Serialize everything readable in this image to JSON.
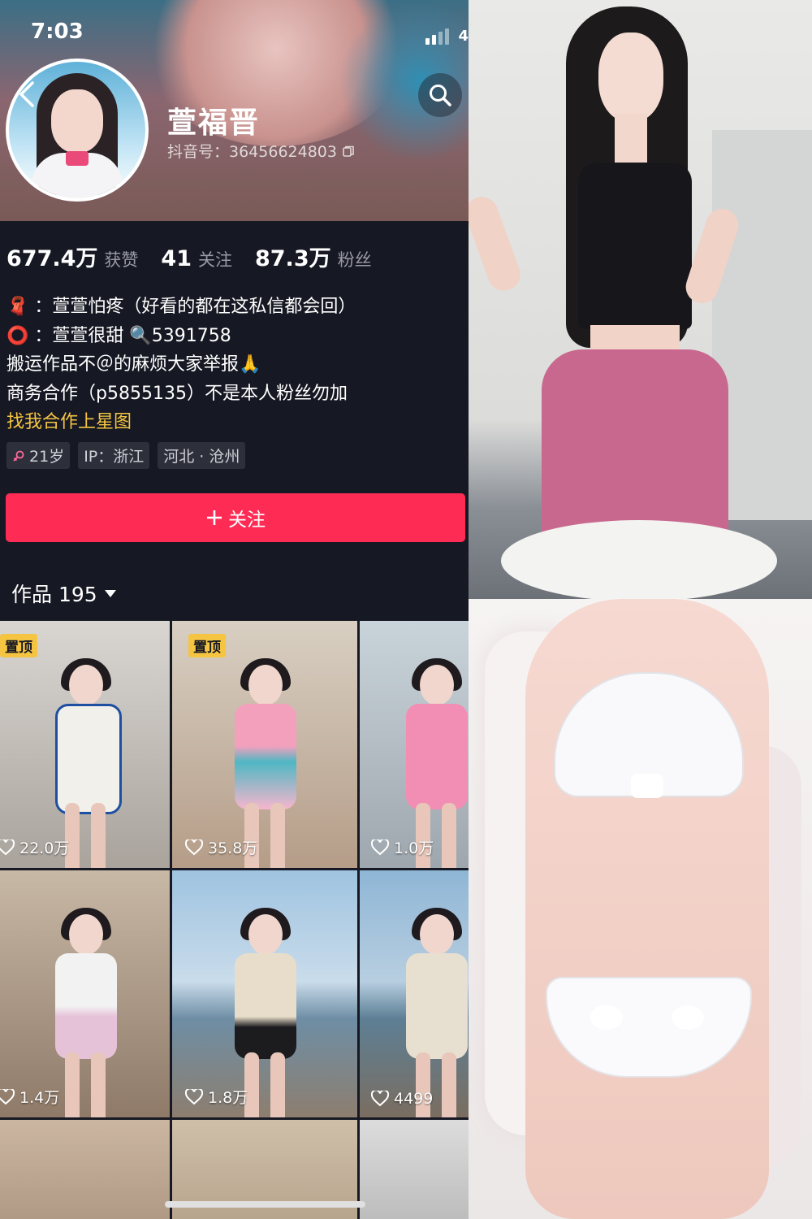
{
  "status_bar": {
    "time": "7:03",
    "battery": "4"
  },
  "profile": {
    "name": "萱福晋",
    "douyin_id": "抖音号：36456624803",
    "stats": [
      {
        "value": "677.4万",
        "label": "获赞"
      },
      {
        "value": "41",
        "label": "关注"
      },
      {
        "value": "87.3万",
        "label": "粉丝"
      }
    ],
    "bio": [
      "🧣 ：萱萱怕疼（好看的都在这私信都会回）",
      "⭕ ：萱萱很甜 🔍5391758",
      "搬运作品不＠的麻烦大家举报🙏",
      "商务合作（p5855135）不是本人粉丝勿加"
    ],
    "star_link": "找我合作上星图",
    "tags": {
      "age": "21岁",
      "ip": "IP：浙江",
      "location": "河北 · 沧州"
    },
    "follow_label": "关注"
  },
  "works": {
    "label": "作品 195",
    "items": [
      {
        "pinned": "置顶",
        "likes": "22.0万"
      },
      {
        "pinned": "置顶",
        "likes": "35.8万"
      },
      {
        "pinned": "",
        "likes": "1.0万"
      },
      {
        "pinned": "",
        "likes": "1.4万"
      },
      {
        "pinned": "",
        "likes": "1.8万"
      },
      {
        "pinned": "",
        "likes": "4499"
      },
      {
        "pinned": "",
        "likes": ""
      },
      {
        "pinned": "",
        "likes": ""
      },
      {
        "pinned": "",
        "likes": ""
      }
    ]
  },
  "colors": {
    "accent": "#fe2c55",
    "pin": "#f5c542",
    "background": "#161823"
  }
}
